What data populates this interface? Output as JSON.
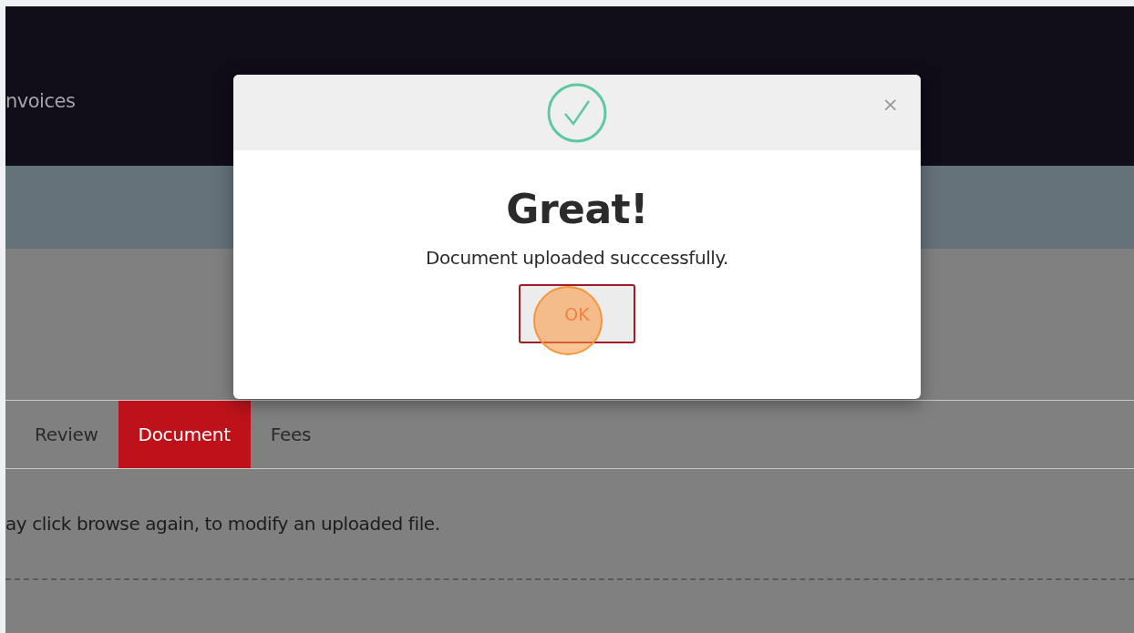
{
  "header": {
    "nav_item": "nvoices"
  },
  "tabs": [
    {
      "label": "Review",
      "selected": false
    },
    {
      "label": "Document",
      "selected": true
    },
    {
      "label": "Fees",
      "selected": false
    }
  ],
  "content": {
    "instruction": "ay click browse again, to modify an uploaded file."
  },
  "dialog": {
    "title": "Great!",
    "message": "Document uploaded succcessfully.",
    "button": "OK",
    "close": "×"
  }
}
